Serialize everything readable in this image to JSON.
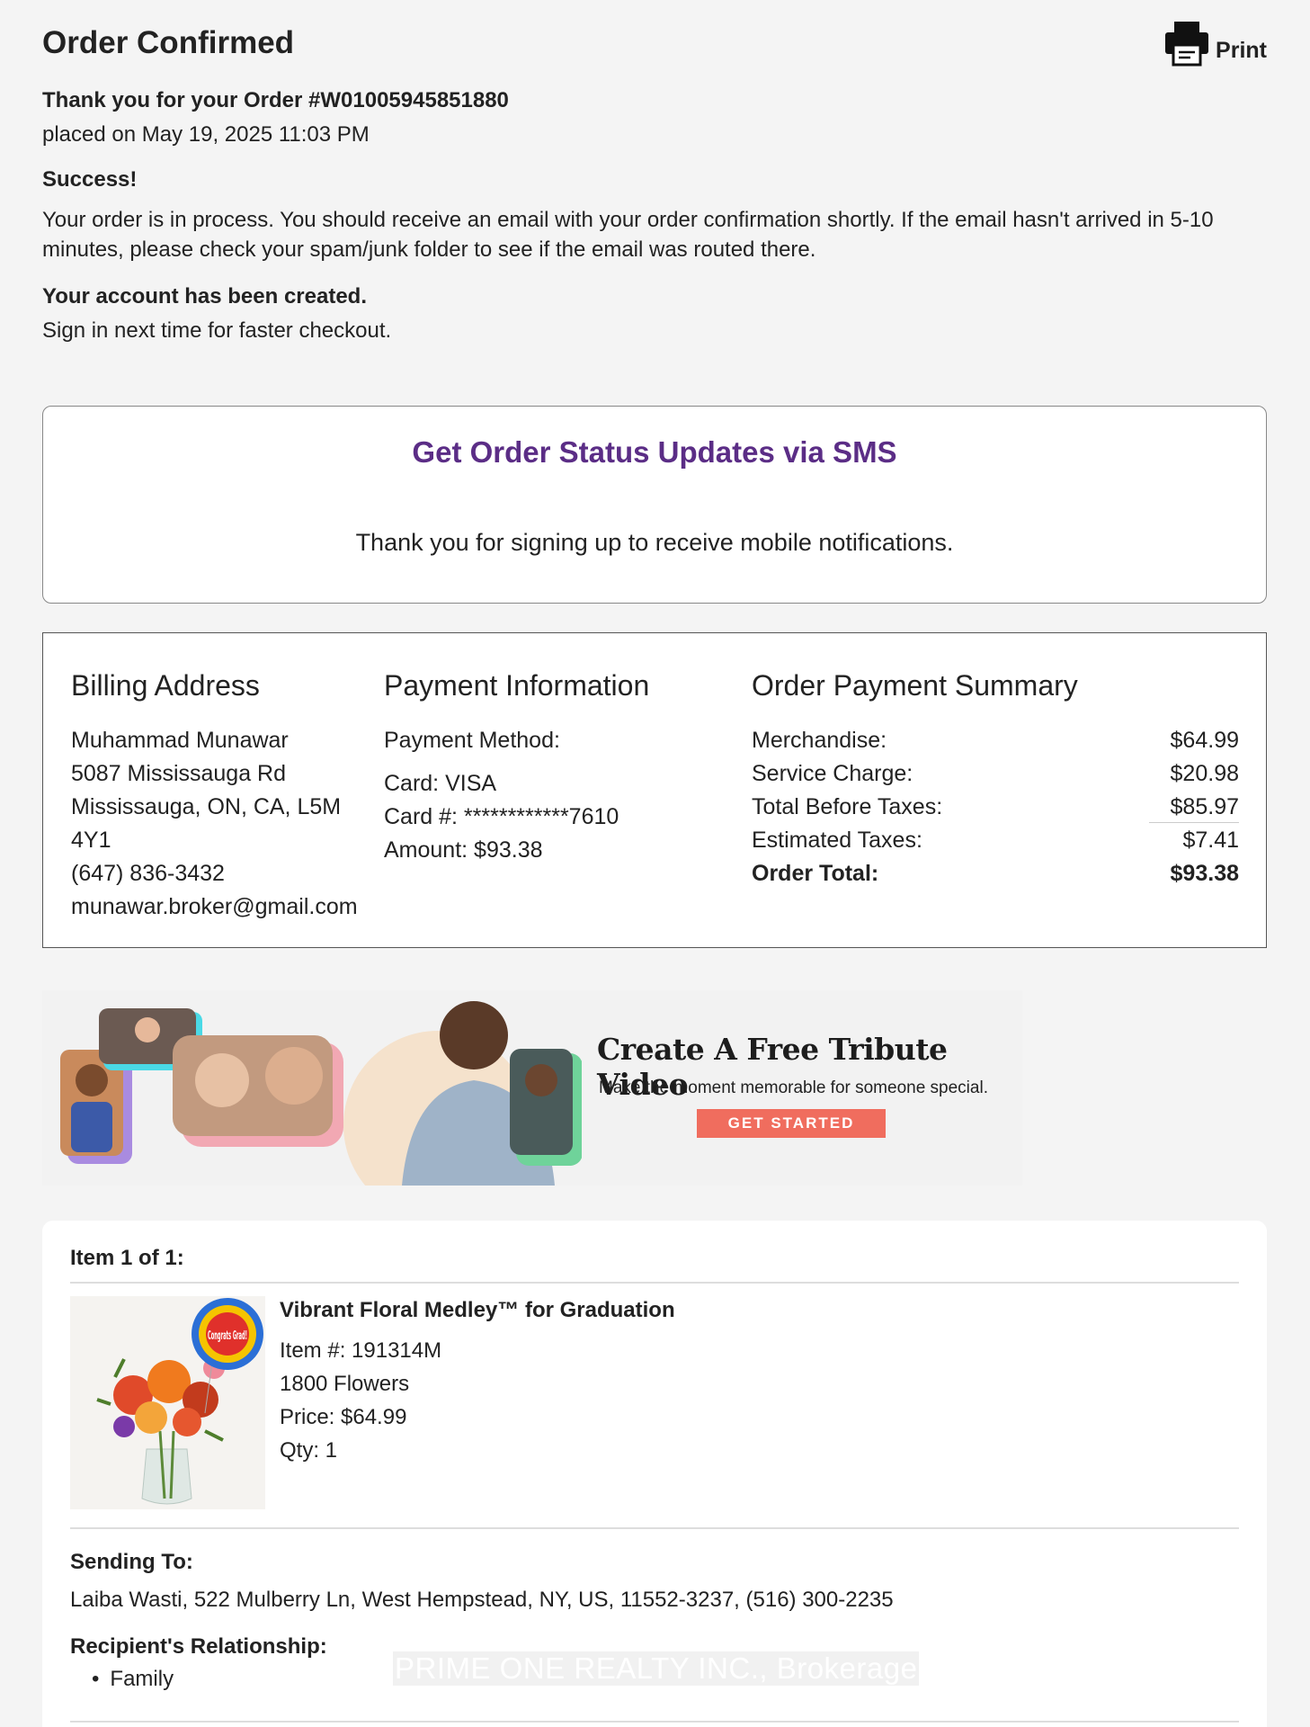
{
  "header": {
    "title": "Order Confirmed",
    "print_label": "Print"
  },
  "order": {
    "thank_you": "Thank you for your Order #W01005945851880",
    "placed": "placed on May 19, 2025 11:03 PM",
    "success_heading": "Success!",
    "message": "Your order is in process. You should receive an email with your order confirmation shortly. If the email hasn't arrived in 5-10 minutes, please check your spam/junk folder to see if the email was routed there.",
    "account_heading": "Your account has been created.",
    "account_text": "Sign in next time for faster checkout."
  },
  "sms": {
    "title": "Get Order Status Updates via SMS",
    "text": "Thank you for signing up to receive mobile notifications.",
    "title_color": "#5b2d86"
  },
  "billing": {
    "heading": "Billing Address",
    "lines": [
      "Muhammad Munawar",
      "5087 Mississauga Rd",
      "Mississauga, ON, CA, L5M",
      "4Y1",
      "(647) 836-3432",
      "munawar.broker@gmail.com"
    ]
  },
  "payment": {
    "heading": "Payment Information",
    "method_label": "Payment Method:",
    "card": "Card: VISA",
    "card_number": "Card #: ************7610",
    "amount": "Amount: $93.38"
  },
  "summary": {
    "heading": "Order Payment Summary",
    "rows": [
      {
        "label": "Merchandise:",
        "value": "$64.99"
      },
      {
        "label": "Service Charge:",
        "value": "$20.98"
      },
      {
        "label": "Total Before Taxes:",
        "value": "$85.97"
      },
      {
        "label": "Estimated Taxes:",
        "value": "$7.41"
      },
      {
        "label": "Order Total:",
        "value": "$93.38"
      }
    ]
  },
  "banner": {
    "title": "Create A Free Tribute Video",
    "subtitle": "Make the moment memorable for someone special.",
    "button": "GET STARTED",
    "button_color": "#f06d5e"
  },
  "item": {
    "count": "Item 1 of 1:",
    "name": "Vibrant Floral Medley™ for Graduation",
    "number": "Item #: 191314M",
    "brand": "1800 Flowers",
    "price": "Price: $64.99",
    "qty": "Qty:  1",
    "balloon_text": "Congrats Grad!",
    "sending_label": "Sending To:",
    "sending_to": "Laiba Wasti, 522 Mulberry Ln, West Hempstead, NY, US, 11552-3237, (516) 300-2235",
    "relationship_label": "Recipient's Relationship:",
    "relationship": "Family"
  },
  "watermark": "PRIME ONE REALTY INC., Brokerage"
}
